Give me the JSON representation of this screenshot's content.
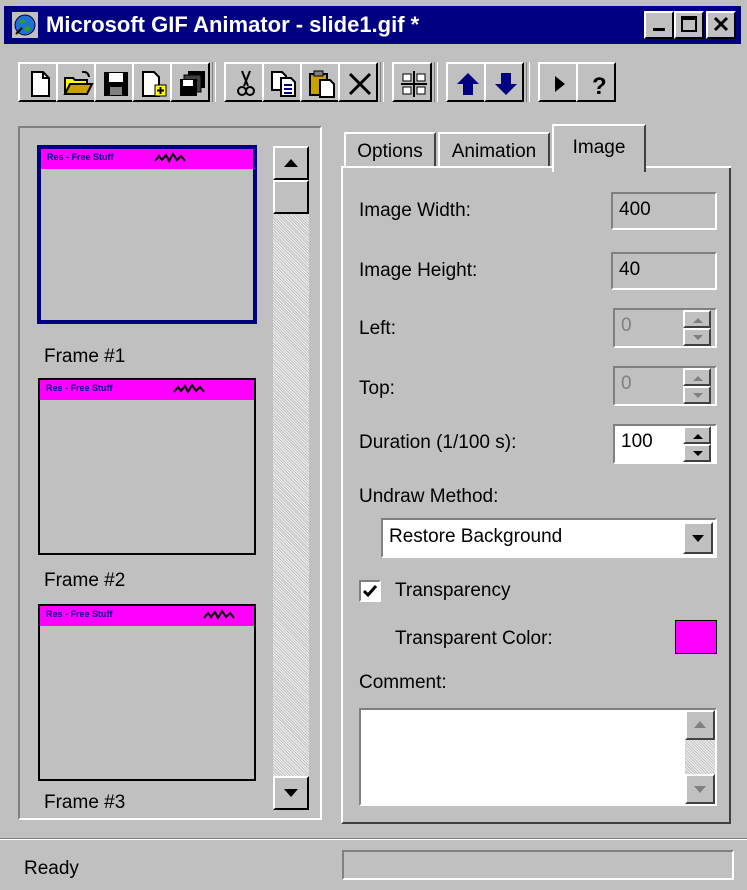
{
  "window": {
    "title": "Microsoft GIF Animator - slide1.gif *",
    "title_icon": "globe-icon"
  },
  "toolbar": {
    "buttons": [
      "new-icon",
      "open-icon",
      "save-icon",
      "insert-icon",
      "save-as-icon",
      "cut-icon",
      "copy-icon",
      "paste-icon",
      "delete-icon",
      "select-all-icon",
      "move-up-icon",
      "move-down-icon",
      "preview-icon",
      "help-icon"
    ]
  },
  "frames": [
    {
      "label": "Frame #1",
      "banner": "Res - Free Stuff"
    },
    {
      "label": "Frame #2",
      "banner": "Res - Free Stuff"
    },
    {
      "label": "Frame #3",
      "banner": "Res - Free Stuff"
    }
  ],
  "tabs": [
    "Options",
    "Animation",
    "Image"
  ],
  "active_tab": "Image",
  "image": {
    "width_label": "Image Width:",
    "width_value": "400",
    "height_label": "Image Height:",
    "height_value": "40",
    "left_label": "Left:",
    "left_value": "0",
    "top_label": "Top:",
    "top_value": "0",
    "duration_label": "Duration (1/100 s):",
    "duration_value": "100",
    "undraw_label": "Undraw Method:",
    "undraw_value": "Restore Background",
    "transparency_label": "Transparency",
    "transparency_checked": true,
    "transparent_color_label": "Transparent Color:",
    "transparent_color": "#ff00ff",
    "comment_label": "Comment:",
    "comment_value": ""
  },
  "status": {
    "text": "Ready"
  },
  "colors": {
    "titlebar": "#000080",
    "selection": "#000080",
    "face": "#c0c0c0",
    "banner": "#ff00ff"
  }
}
